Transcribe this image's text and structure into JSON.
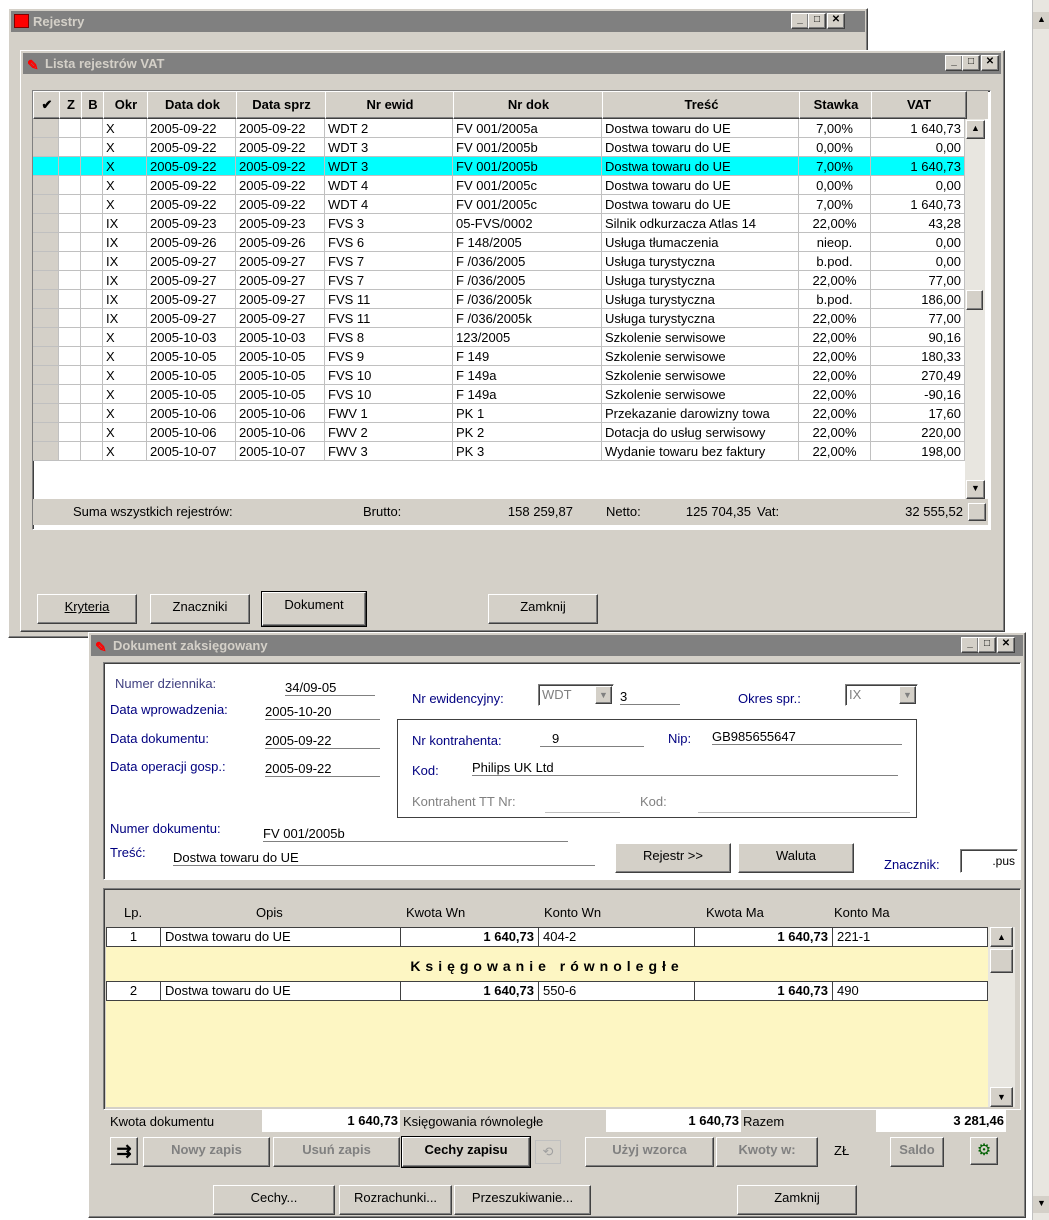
{
  "outer": {
    "title": "Rejestry"
  },
  "vat_window": {
    "title": "Lista rejestrów VAT",
    "columns": [
      "✔",
      "Z",
      "B",
      "Okr",
      "Data dok",
      "Data sprz",
      "Nr ewid",
      "Nr dok",
      "Treść",
      "Stawka",
      "VAT"
    ],
    "rows": [
      [
        "",
        "",
        "",
        "X",
        "2005-09-22",
        "2005-09-22",
        "WDT 2",
        "FV 001/2005a",
        "Dostwa towaru do UE",
        "7,00%",
        "1 640,73"
      ],
      [
        "",
        "",
        "",
        "X",
        "2005-09-22",
        "2005-09-22",
        "WDT 3",
        "FV 001/2005b",
        "Dostwa towaru do UE",
        "0,00%",
        "0,00"
      ],
      [
        "",
        "",
        "",
        "X",
        "2005-09-22",
        "2005-09-22",
        "WDT 3",
        "FV 001/2005b",
        "Dostwa towaru do UE",
        "7,00%",
        "1 640,73"
      ],
      [
        "",
        "",
        "",
        "X",
        "2005-09-22",
        "2005-09-22",
        "WDT 4",
        "FV 001/2005c",
        "Dostwa towaru do UE",
        "0,00%",
        "0,00"
      ],
      [
        "",
        "",
        "",
        "X",
        "2005-09-22",
        "2005-09-22",
        "WDT 4",
        "FV 001/2005c",
        "Dostwa towaru do UE",
        "7,00%",
        "1 640,73"
      ],
      [
        "",
        "",
        "",
        "IX",
        "2005-09-23",
        "2005-09-23",
        "FVS 3",
        "05-FVS/0002",
        "Silnik odkurzacza Atlas 14",
        "22,00%",
        "43,28"
      ],
      [
        "",
        "",
        "",
        "IX",
        "2005-09-26",
        "2005-09-26",
        "FVS 6",
        "F 148/2005",
        "Usługa tłumaczenia",
        "nieop.",
        "0,00"
      ],
      [
        "",
        "",
        "",
        "IX",
        "2005-09-27",
        "2005-09-27",
        "FVS 7",
        "F /036/2005",
        "Usługa turystyczna",
        "b.pod.",
        "0,00"
      ],
      [
        "",
        "",
        "",
        "IX",
        "2005-09-27",
        "2005-09-27",
        "FVS 7",
        "F /036/2005",
        "Usługa turystyczna",
        "22,00%",
        "77,00"
      ],
      [
        "",
        "",
        "",
        "IX",
        "2005-09-27",
        "2005-09-27",
        "FVS 11",
        "F /036/2005k",
        "Usługa turystyczna",
        "b.pod.",
        "186,00"
      ],
      [
        "",
        "",
        "",
        "IX",
        "2005-09-27",
        "2005-09-27",
        "FVS 11",
        "F /036/2005k",
        "Usługa turystyczna",
        "22,00%",
        "77,00"
      ],
      [
        "",
        "",
        "",
        "X",
        "2005-10-03",
        "2005-10-03",
        "FVS 8",
        "123/2005",
        "Szkolenie serwisowe",
        "22,00%",
        "90,16"
      ],
      [
        "",
        "",
        "",
        "X",
        "2005-10-05",
        "2005-10-05",
        "FVS 9",
        "F 149",
        "Szkolenie serwisowe",
        "22,00%",
        "180,33"
      ],
      [
        "",
        "",
        "",
        "X",
        "2005-10-05",
        "2005-10-05",
        "FVS 10",
        "F 149a",
        "Szkolenie serwisowe",
        "22,00%",
        "270,49"
      ],
      [
        "",
        "",
        "",
        "X",
        "2005-10-05",
        "2005-10-05",
        "FVS 10",
        "F 149a",
        "Szkolenie serwisowe",
        "22,00%",
        "-90,16"
      ],
      [
        "",
        "",
        "",
        "X",
        "2005-10-06",
        "2005-10-06",
        "FWV 1",
        "PK 1",
        "Przekazanie darowizny towa",
        "22,00%",
        "17,60"
      ],
      [
        "",
        "",
        "",
        "X",
        "2005-10-06",
        "2005-10-06",
        "FWV 2",
        "PK 2",
        "Dotacja do usług serwisowy",
        "22,00%",
        "220,00"
      ],
      [
        "",
        "",
        "",
        "X",
        "2005-10-07",
        "2005-10-07",
        "FWV 3",
        "PK 3",
        "Wydanie towaru bez faktury",
        "22,00%",
        "198,00"
      ]
    ],
    "selected_row": 2,
    "totals": {
      "label": "Suma wszystkich rejestrów:",
      "brutto_label": "Brutto:",
      "brutto": "158 259,87",
      "netto_label": "Netto:",
      "netto": "125 704,35",
      "vat_label": "Vat:",
      "vat": "32 555,52"
    },
    "buttons": {
      "kryteria": "Kryteria",
      "znaczniki": "Znaczniki",
      "dokument": "Dokument",
      "zamknij": "Zamknij"
    }
  },
  "doc_window": {
    "title": "Dokument zaksięgowany",
    "numer_dziennika_label": "Numer dziennika:",
    "numer_dziennika": "34/09-05",
    "data_wprowadzenia_label": "Data wprowadzenia:",
    "data_wprowadzenia": "2005-10-20",
    "data_dokumentu_label": "Data dokumentu:",
    "data_dokumentu": "2005-09-22",
    "data_operacji_label": "Data operacji gosp.:",
    "data_operacji": "2005-09-22",
    "nr_ewid_label": "Nr ewidencyjny:",
    "nr_ewid_select": "WDT",
    "nr_ewid_num": "3",
    "okres_label": "Okres spr.:",
    "okres": "IX",
    "nr_kontrahenta_label": "Nr kontrahenta:",
    "nr_kontrahenta": "9",
    "nip_label": "Nip:",
    "nip": "GB985655647",
    "kod_label": "Kod:",
    "kod": "Philips UK Ltd",
    "kontrahent_tt_label": "Kontrahent TT Nr:",
    "kod2_label": "Kod:",
    "numer_dokumentu_label": "Numer dokumentu:",
    "numer_dokumentu": "FV 001/2005b",
    "tresc_label": "Treść:",
    "tresc": "Dostwa towaru do UE",
    "rejestr_btn": "Rejestr >>",
    "waluta_btn": "Waluta",
    "znacznik_label": "Znacznik:",
    "znacznik": ".pus",
    "entries_columns": [
      "Lp.",
      "Opis",
      "Kwota Wn",
      "Konto Wn",
      "Kwota Ma",
      "Konto Ma"
    ],
    "entries": [
      {
        "lp": "1",
        "opis": "Dostwa towaru do UE",
        "kwota_wn": "1 640,73",
        "konto_wn": "404-2",
        "kwota_ma": "1 640,73",
        "konto_ma": "221-1"
      },
      {
        "lp": "2",
        "opis": "Dostwa towaru do UE",
        "kwota_wn": "1 640,73",
        "konto_wn": "550-6",
        "kwota_ma": "1 640,73",
        "konto_ma": "490"
      }
    ],
    "parallel_label": "Księgowanie równoległe",
    "kwota_dokumentu_label": "Kwota dokumentu",
    "kwota_dokumentu": "1 640,73",
    "ksieg_rown_label": "Księgowania równoległe",
    "ksieg_rown": "1 640,73",
    "razem_label": "Razem",
    "razem": "3 281,46",
    "toolbar": {
      "nowy": "Nowy zapis",
      "usun": "Usuń zapis",
      "cechy_zapisu": "Cechy zapisu",
      "uzyj_wzorca": "Użyj wzorca",
      "kwoty_w": "Kwoty w:",
      "currency": "ZŁ",
      "saldo": "Saldo"
    },
    "bottom": {
      "cechy": "Cechy...",
      "rozrachunki": "Rozrachunki...",
      "przeszukiwanie": "Przeszukiwanie...",
      "zamknij": "Zamknij"
    }
  },
  "colors": {
    "selection": "#00ffff",
    "entries_bg": "#fdf6c3",
    "face": "#d4d0c8",
    "titlebar": "#808080"
  }
}
